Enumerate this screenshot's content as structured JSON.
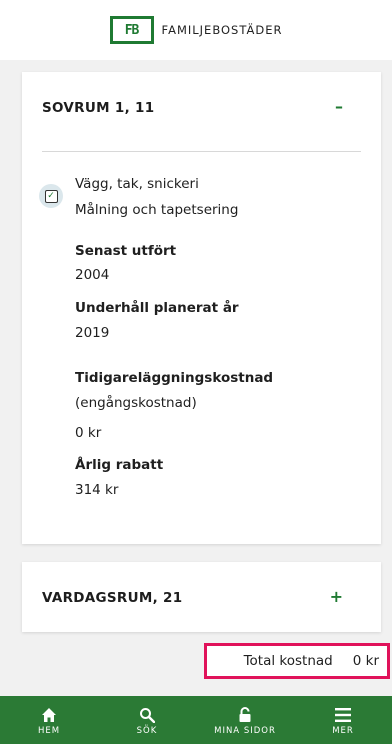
{
  "header": {
    "logo_letters": "FB",
    "brand": "FAMILJEBOSTÄDER"
  },
  "card1": {
    "title": "SOVRUM 1, 11",
    "toggle": "–",
    "checkbox_checked": true,
    "item_line1": "Vägg, tak, snickeri",
    "item_line2": "Målning och tapetsering",
    "senast_label": "Senast utfört",
    "senast_value": "2004",
    "underhall_label": "Underhåll planerat år",
    "underhall_value": "2019",
    "tidig_label": "Tidigareläggningskostnad",
    "tidig_sub": "(engångskostnad)",
    "tidig_value": "0 kr",
    "rabatt_label": "Årlig rabatt",
    "rabatt_value": "314 kr"
  },
  "card2": {
    "title": "VARDAGSRUM, 21",
    "toggle": "+"
  },
  "total": {
    "label": "Total kostnad",
    "value": "0 kr"
  },
  "nav": [
    {
      "label": "HEM",
      "icon": "home-icon"
    },
    {
      "label": "SÖK",
      "icon": "search-icon"
    },
    {
      "label": "MINA SIDOR",
      "icon": "lock-icon"
    },
    {
      "label": "MER",
      "icon": "menu-icon"
    }
  ],
  "colors": {
    "brand_green": "#2b7a35",
    "highlight": "#e0125a"
  }
}
